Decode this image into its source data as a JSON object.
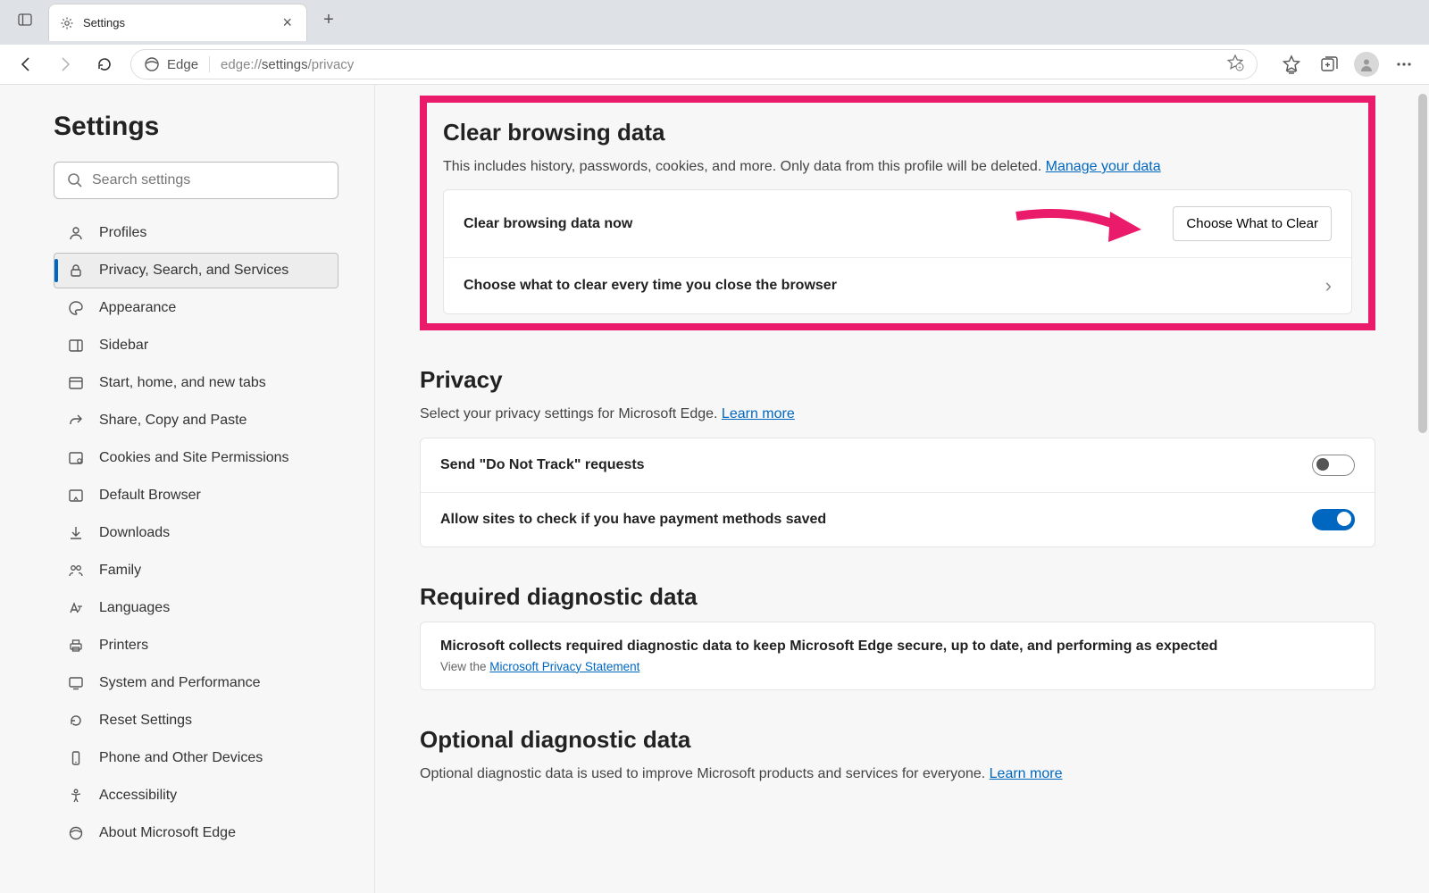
{
  "tab": {
    "title": "Settings"
  },
  "address": {
    "chip": "Edge",
    "prefix": "edge://",
    "bold": "settings",
    "suffix": "/privacy"
  },
  "sidebar": {
    "title": "Settings",
    "search_placeholder": "Search settings",
    "items": [
      {
        "label": "Profiles",
        "icon": "user-icon"
      },
      {
        "label": "Privacy, Search, and Services",
        "icon": "lock-icon"
      },
      {
        "label": "Appearance",
        "icon": "palette-icon"
      },
      {
        "label": "Sidebar",
        "icon": "panel-icon"
      },
      {
        "label": "Start, home, and new tabs",
        "icon": "window-icon"
      },
      {
        "label": "Share, Copy and Paste",
        "icon": "share-icon"
      },
      {
        "label": "Cookies and Site Permissions",
        "icon": "cookie-icon"
      },
      {
        "label": "Default Browser",
        "icon": "browser-icon"
      },
      {
        "label": "Downloads",
        "icon": "download-icon"
      },
      {
        "label": "Family",
        "icon": "family-icon"
      },
      {
        "label": "Languages",
        "icon": "languages-icon"
      },
      {
        "label": "Printers",
        "icon": "printer-icon"
      },
      {
        "label": "System and Performance",
        "icon": "system-icon"
      },
      {
        "label": "Reset Settings",
        "icon": "reset-icon"
      },
      {
        "label": "Phone and Other Devices",
        "icon": "phone-icon"
      },
      {
        "label": "Accessibility",
        "icon": "accessibility-icon"
      },
      {
        "label": "About Microsoft Edge",
        "icon": "edge-icon"
      }
    ]
  },
  "clear_data": {
    "title": "Clear browsing data",
    "desc": "This includes history, passwords, cookies, and more. Only data from this profile will be deleted. ",
    "manage_link": "Manage your data",
    "row1_label": "Clear browsing data now",
    "row1_button": "Choose What to Clear",
    "row2_label": "Choose what to clear every time you close the browser"
  },
  "privacy": {
    "title": "Privacy",
    "desc": "Select your privacy settings for Microsoft Edge. ",
    "learn_more": "Learn more",
    "row1": "Send \"Do Not Track\" requests",
    "row2": "Allow sites to check if you have payment methods saved"
  },
  "diag": {
    "title": "Required diagnostic data",
    "row1": "Microsoft collects required diagnostic data to keep Microsoft Edge secure, up to date, and performing as expected",
    "row1_sub_prefix": "View the ",
    "row1_sub_link": "Microsoft Privacy Statement"
  },
  "optional": {
    "title": "Optional diagnostic data",
    "desc": "Optional diagnostic data is used to improve Microsoft products and services for everyone. ",
    "learn_more": "Learn more"
  }
}
